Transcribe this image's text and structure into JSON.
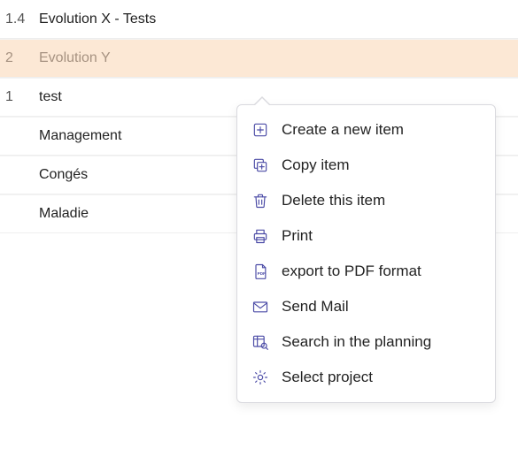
{
  "rows": [
    {
      "num": "1.4",
      "label": "Evolution X - Tests",
      "highlight": false
    },
    {
      "num": "2",
      "label": "Evolution Y",
      "highlight": true
    },
    {
      "num": "1",
      "label": "test",
      "highlight": false
    },
    {
      "num": "",
      "label": "Management",
      "highlight": false
    },
    {
      "num": "",
      "label": "Congés",
      "highlight": false
    },
    {
      "num": "",
      "label": "Maladie",
      "highlight": false
    }
  ],
  "menu": [
    {
      "id": "create",
      "label": "Create a new item",
      "icon": "plus-box-icon"
    },
    {
      "id": "copy",
      "label": "Copy item",
      "icon": "copy-icon"
    },
    {
      "id": "delete",
      "label": "Delete this item",
      "icon": "trash-icon"
    },
    {
      "id": "print",
      "label": "Print",
      "icon": "print-icon"
    },
    {
      "id": "pdf",
      "label": "export to PDF format",
      "icon": "pdf-icon"
    },
    {
      "id": "mail",
      "label": "Send Mail",
      "icon": "mail-icon"
    },
    {
      "id": "search",
      "label": "Search in the planning",
      "icon": "search-planning-icon"
    },
    {
      "id": "project",
      "label": "Select project",
      "icon": "gear-icon"
    }
  ]
}
